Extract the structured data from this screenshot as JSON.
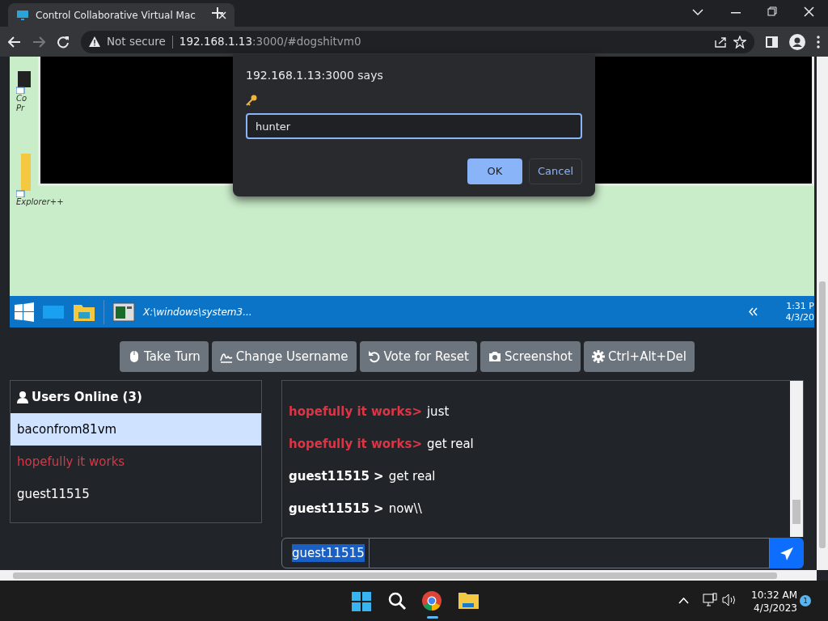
{
  "browser": {
    "tab_title": "Control Collaborative Virtual Mac",
    "security": "Not secure",
    "url_host": "192.168.1.13",
    "url_rest": ":3000/#dogshitvm0"
  },
  "dialog": {
    "title": "192.168.1.13:3000 says",
    "value": "hunter",
    "buttons": [
      {
        "label": "OK",
        "primary": true
      },
      {
        "label": "Cancel",
        "primary": false
      }
    ]
  },
  "vm": {
    "desktop_icons": [
      {
        "lines": [
          "Co",
          "Pr"
        ]
      },
      {
        "lines": [
          "Explorer++"
        ]
      }
    ],
    "taskbar": {
      "window_title": "X:\\windows\\system3...",
      "time": "1:31 P",
      "date": "4/3/20"
    }
  },
  "toolbar": [
    {
      "kind": "mouse",
      "label": "Take Turn"
    },
    {
      "kind": "signature",
      "label": "Change Username"
    },
    {
      "kind": "undo",
      "label": "Vote for Reset"
    },
    {
      "kind": "camera",
      "label": "Screenshot"
    },
    {
      "kind": "gear",
      "label": "Ctrl+Alt+Del"
    }
  ],
  "users": {
    "title": "Users Online (3)",
    "items": [
      {
        "name": "baconfrom81vm",
        "selected": true,
        "color": "#000000"
      },
      {
        "name": "hopefully it works",
        "selected": false,
        "color": "#dc3545"
      },
      {
        "name": "guest11515",
        "selected": false,
        "color": "#ffffff"
      }
    ]
  },
  "chat": {
    "messages": [
      {
        "user": "hopefully it works>",
        "color": "#dc3545",
        "text": "just"
      },
      {
        "user": "hopefully it works>",
        "color": "#dc3545",
        "text": "get real"
      },
      {
        "user": "guest11515 >",
        "color": "#ffffff",
        "text": "get real"
      },
      {
        "user": "guest11515 >",
        "color": "#ffffff",
        "text": "now\\\\"
      }
    ],
    "username": "guest11515"
  },
  "os_taskbar": {
    "time": "10:32 AM",
    "date": "4/3/2023",
    "notifications": "1"
  }
}
